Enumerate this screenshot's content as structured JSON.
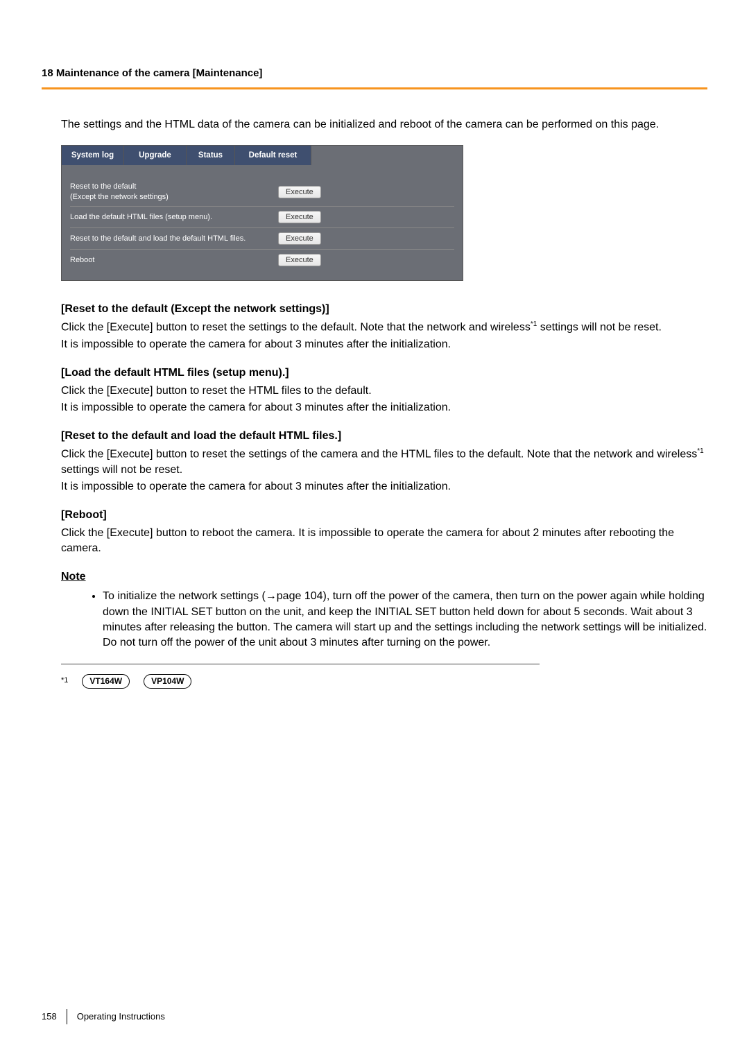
{
  "header": {
    "chapter": "18 Maintenance of the camera [Maintenance]"
  },
  "intro": "The settings and the HTML data of the camera can be initialized and reboot of the camera can be performed on this page.",
  "tabs": {
    "system_log": "System log",
    "upgrade": "Upgrade",
    "status": "Status",
    "default_reset": "Default reset"
  },
  "settings": {
    "row1_label": "Reset to the default\n(Except the network settings)",
    "row2_label": "Load the default HTML files (setup menu).",
    "row3_label": "Reset to the default and load the default HTML files.",
    "row4_label": "Reboot",
    "execute": "Execute"
  },
  "sections": {
    "s1": {
      "heading": "[Reset to the default (Except the network settings)]",
      "p1a": "Click the [Execute] button to reset the settings to the default. Note that the network and wireless",
      "p1b": " settings will not be reset.",
      "p2": "It is impossible to operate the camera for about 3 minutes after the initialization."
    },
    "s2": {
      "heading": "[Load the default HTML files (setup menu).]",
      "p1": "Click the [Execute] button to reset the HTML files to the default.",
      "p2": "It is impossible to operate the camera for about 3 minutes after the initialization."
    },
    "s3": {
      "heading": "[Reset to the default and load the default HTML files.]",
      "p1a": "Click the [Execute] button to reset the settings of the camera and the HTML files to the default. Note that the network and wireless",
      "p1b": " settings will not be reset.",
      "p2": "It is impossible to operate the camera for about 3 minutes after the initialization."
    },
    "s4": {
      "heading": "[Reboot]",
      "p1": "Click the [Execute] button to reboot the camera. It is impossible to operate the camera for about 2 minutes after rebooting the camera."
    }
  },
  "note": {
    "heading": "Note",
    "item1": "To initialize the network settings (→page 104), turn off the power of the camera, then turn on the power again while holding down the INITIAL SET button on the unit, and keep the INITIAL SET button held down for about 5 seconds. Wait about 3 minutes after releasing the button. The camera will start up and the settings including the network settings will be initialized. Do not turn off the power of the unit about 3 minutes after turning on the power."
  },
  "footnote": {
    "marker": "*1",
    "badge1": "VT164W",
    "badge2": "VP104W"
  },
  "footer": {
    "page": "158",
    "label": "Operating Instructions"
  }
}
